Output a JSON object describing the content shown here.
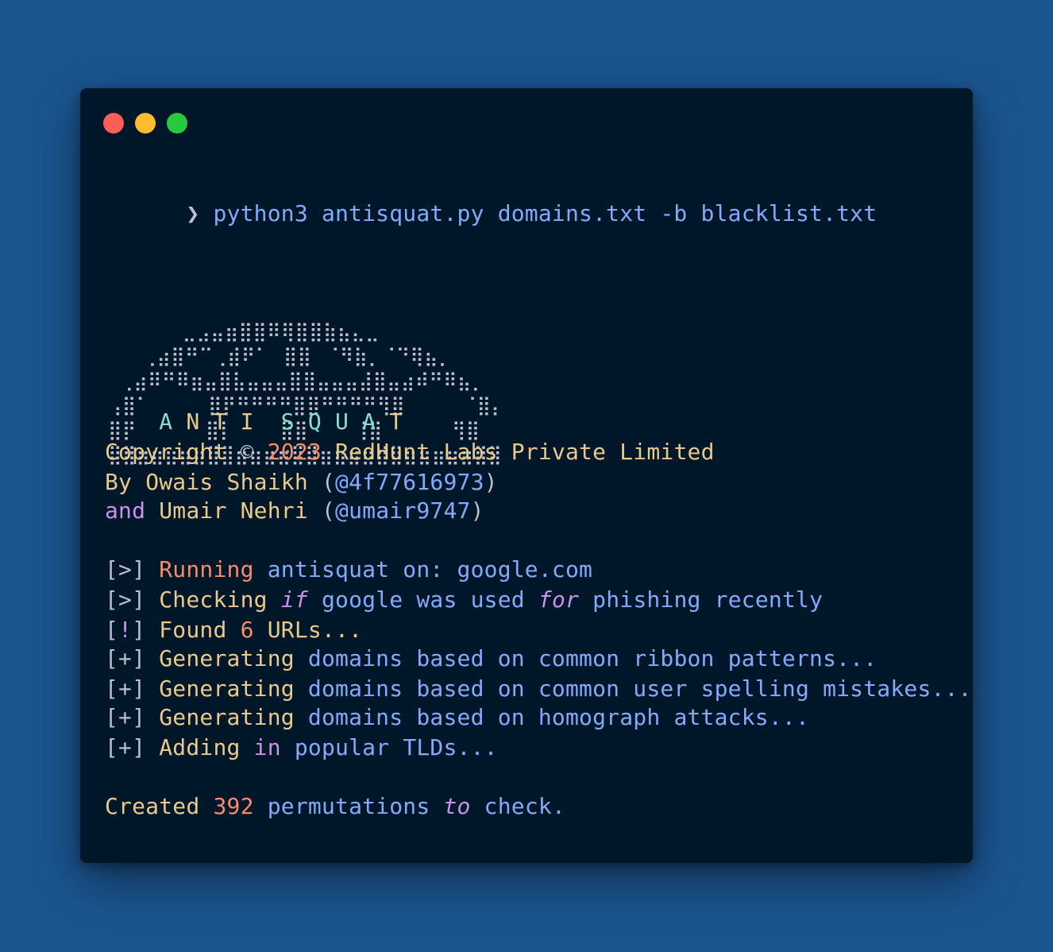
{
  "colors": {
    "background": "#1b5590",
    "terminal_bg": "#001729",
    "blue": "#82aaff",
    "yellow": "#e9ca8c",
    "orange": "#f78c6c",
    "purple": "#c792ea",
    "teal": "#89ddd0",
    "gray": "#b9bfcc"
  },
  "window": {
    "buttons": [
      {
        "name": "close",
        "color": "#ff5f56"
      },
      {
        "name": "minimize",
        "color": "#ffbd2e"
      },
      {
        "name": "zoom",
        "color": "#27c93f"
      }
    ]
  },
  "command": {
    "prompt": "❯",
    "text": "python3 antisquat.py domains.txt -b blacklist.txt"
  },
  "banner": {
    "art": [
      "    ⠀⠀⣀⣠⣤⣶⣿⣿⠿⢿⣿⣿⣷⣦⣄⣀⠀⠀",
      "   ⢀⣴⣿⠛⠉⢀⣾⠟⠁⠀⣿⣿⠀⠈⠻⣷⡀⠈⠙⢿⣦⡀",
      " ⢀⣴⠿⠛⠿⣶⣤⣿⣧⣤⣤⣤⣿⣿⣤⣤⣤⣼⣿⣤⣴⠾⠛⠿⣦⡀",
      "⢠⣿⠁     ⣿⡟⠛⠛⠛⠛⣿⣿⠛⠛⠛⠛⢻⣿     ⠈⣿⡄",
      "⣿⡟      ⣿⡇    ⣿⣿    ⢸⣿      ⢻⣿",
      "⣿⣿⣶⣶⣶⣶⣶⣿⣿⣶⣶⣶⣶⣿⣿⣶⣶⣶⣶⣾⣿⣶⣶⣶⣶⣶⣿⣿"
    ],
    "title_letters": [
      "A",
      "N",
      "T",
      "I",
      "S",
      "Q",
      "U",
      "A",
      "T"
    ]
  },
  "copyright": {
    "word": "Copyright",
    "symbol": "©",
    "year": "2023",
    "company": "RedHunt Labs Private Limited"
  },
  "authors": [
    {
      "prefix": "By",
      "name": "Owais Shaikh",
      "open": "(",
      "handle": "@4f77616973",
      "close": ")"
    },
    {
      "prefix": "and",
      "name": "Umair Nehri",
      "open": "(",
      "handle": "@umair9747",
      "close": ")"
    }
  ],
  "log": {
    "running": {
      "bracket": "[>]",
      "verb": "Running",
      "rest": "antisquat on: google.com"
    },
    "checking": {
      "bracket": "[>]",
      "verb": "Checking",
      "kw1": "if",
      "mid": "google was used",
      "kw2": "for",
      "rest": "phishing recently"
    },
    "found": {
      "bracket_open": "[",
      "mark": "!",
      "bracket_close": "]",
      "verb": "Found",
      "count": "6",
      "rest": "URLs..."
    },
    "ribbon": {
      "bracket": "[+]",
      "verb": "Generating",
      "rest": "domains based on common ribbon patterns..."
    },
    "spelling": {
      "bracket": "[+]",
      "verb": "Generating",
      "rest": "domains based on common user spelling mistakes..."
    },
    "homograph": {
      "bracket": "[+]",
      "verb": "Generating",
      "rest": "domains based on homograph attacks..."
    },
    "tlds": {
      "bracket": "[+]",
      "verb": "Adding",
      "kw": "in",
      "rest": "popular TLDs..."
    }
  },
  "summary": {
    "word": "Created",
    "count": "392",
    "mid": "permutations",
    "kw": "to",
    "rest": "check."
  }
}
